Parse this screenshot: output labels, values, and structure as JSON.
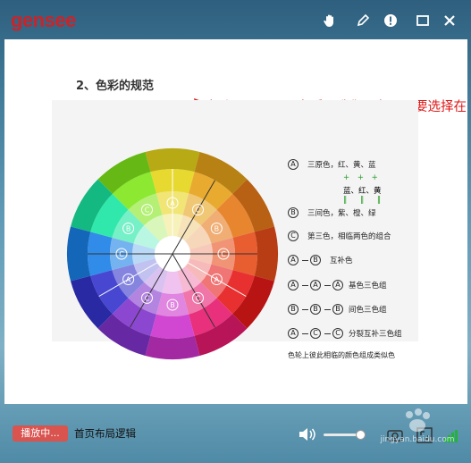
{
  "titlebar": {
    "logo": "gensee",
    "icons": [
      "hand-icon",
      "pen-icon",
      "alert-icon",
      "maximize-icon",
      "close-icon"
    ]
  },
  "slide": {
    "heading": "2、色彩的规范",
    "red_note": "每个圈属于同一色系，我们取色，需要选择在同一色系才让人感觉舒服",
    "legend": {
      "primary_label": "三原色，红、黄、蓝",
      "plus_row": "+ + +",
      "secondary_top": "蓝、红、黄",
      "eq_row": "‖ ‖ ‖",
      "secondary_label": "三间色，紫、橙、绿",
      "tertiary_label": "第三色，相临两色的组合",
      "complement_label": "互补色",
      "triad_label": "基色三色组",
      "interval_triad_label": "间色三色组",
      "split_label": "分裂互补三色组",
      "analog_label": "色轮上彼此相临的颜色组成类似色",
      "letters": {
        "a": "A",
        "b": "B",
        "c": "C"
      }
    }
  },
  "controls": {
    "status": "播放中...",
    "doc": "首页布局逻辑",
    "volume": 0.55,
    "signal_bars": 4
  },
  "watermark": {
    "site": "jingyan.baidu.com"
  }
}
